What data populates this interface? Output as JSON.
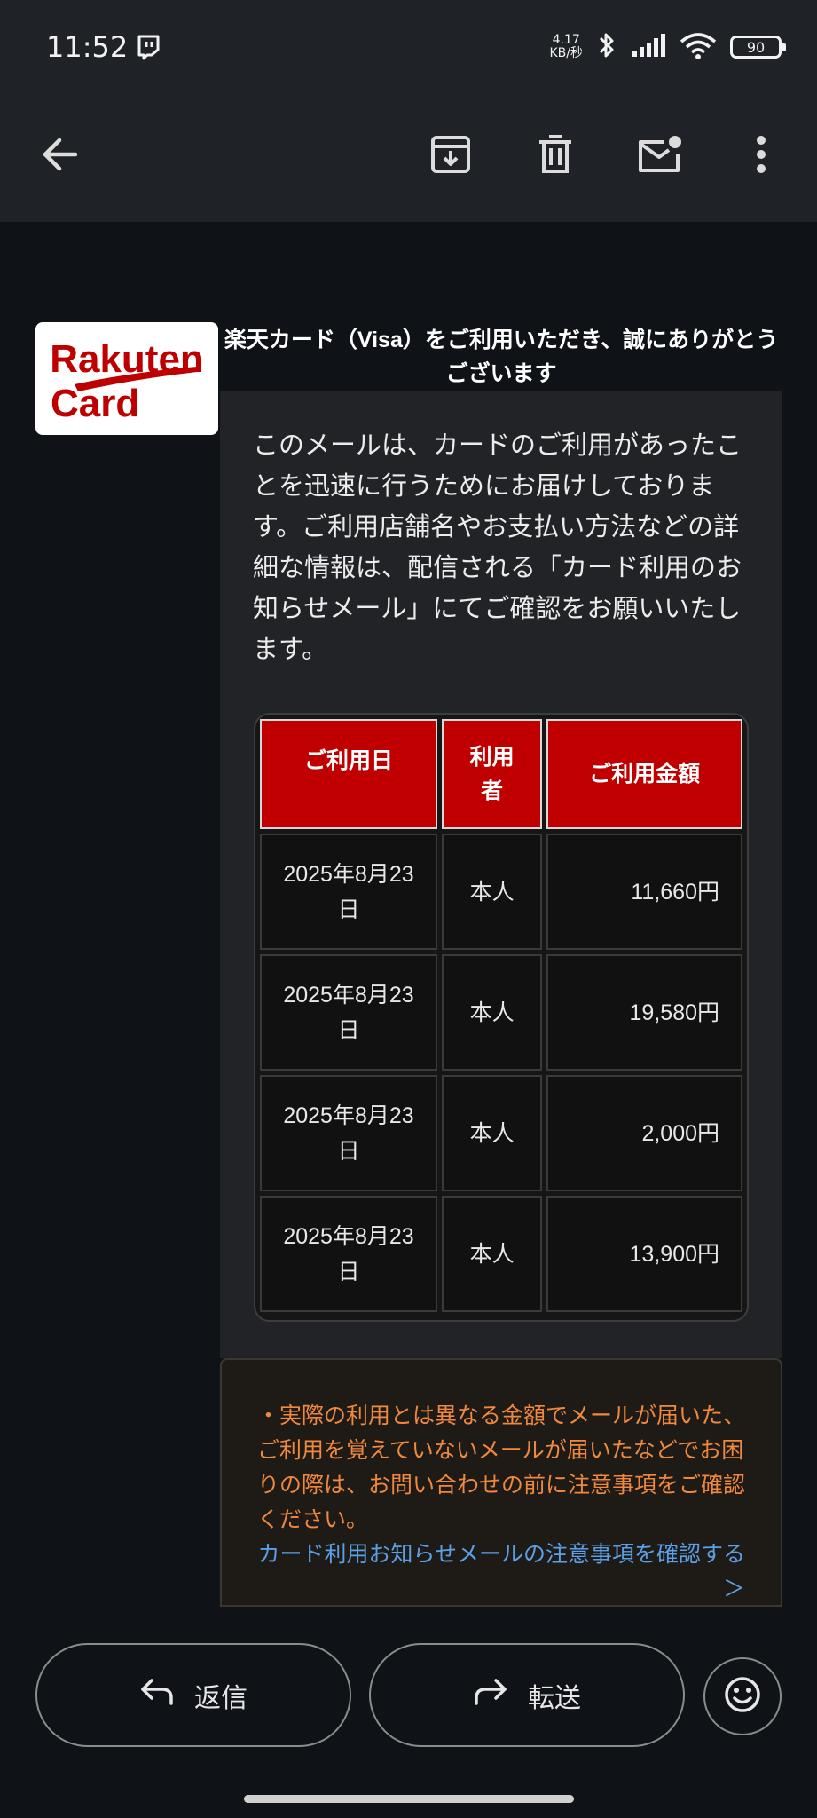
{
  "status_bar": {
    "time": "11:52",
    "net_speed_value": "4.17",
    "net_speed_unit": "KB/秒",
    "battery": "90"
  },
  "toolbar": {
    "back_icon": "arrow-left-icon",
    "archive_icon": "archive-icon",
    "delete_icon": "trash-icon",
    "mark_unread_icon": "mail-unread-icon",
    "more_icon": "more-vert-icon"
  },
  "email": {
    "logo_line1": "Rakuten",
    "logo_line2": "Card",
    "heading": "楽天カード（Visa）をご利用いただき、誠にありがとうございます",
    "intro": "このメールは、カードのご利用があったことを迅速に行うためにお届けしております。ご利用店舗名やお支払い方法などの詳細な情報は、配信される「カード利用のお知らせメール」にてご確認をお願いいたします。",
    "table": {
      "headers": {
        "date": "ご利用日",
        "user": "利用者",
        "amount": "ご利用金額"
      },
      "rows": [
        {
          "date": "2025年8月23日",
          "user": "本人",
          "amount": "11,660円"
        },
        {
          "date": "2025年8月23日",
          "user": "本人",
          "amount": "19,580円"
        },
        {
          "date": "2025年8月23日",
          "user": "本人",
          "amount": "2,000円"
        },
        {
          "date": "2025年8月23日",
          "user": "本人",
          "amount": "13,900円"
        }
      ]
    },
    "notice": "・実際の利用とは異なる金額でメールが届いた、ご利用を覚えていないメールが届いたなどでお困りの際は、お問い合わせの前に注意事項をご確認ください。",
    "notice_link": "カード利用お知らせメールの注意事項を確認する＞"
  },
  "actions": {
    "reply_label": "返信",
    "forward_label": "転送"
  },
  "colors": {
    "brand_red": "#c00000",
    "notice_orange": "#f0883e",
    "link_blue": "#5aa0e8"
  }
}
